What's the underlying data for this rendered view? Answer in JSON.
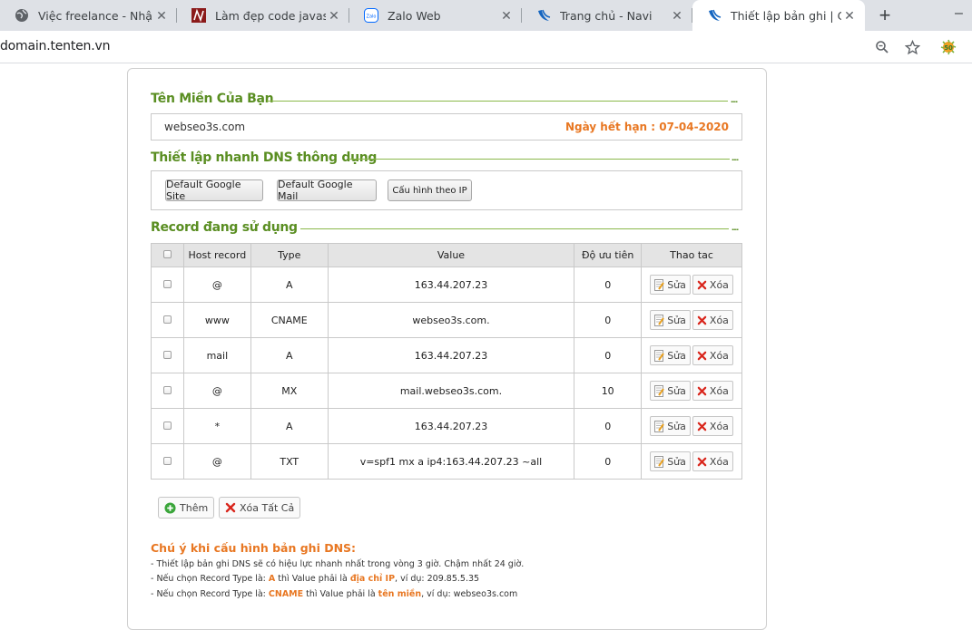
{
  "browser": {
    "tabs": [
      {
        "title": "Việc freelance - Nhận tiền",
        "icon": "globe-icon"
      },
      {
        "title": "Làm đẹp code javascript",
        "icon": "site-n-icon"
      },
      {
        "title": "Zalo Web",
        "icon": "zalo-icon"
      },
      {
        "title": "Trang chủ - Navi",
        "icon": "navi-icon"
      },
      {
        "title": "Thiết lập bản ghi | Cài đặt",
        "icon": "navi-icon"
      }
    ],
    "new_tab": "+",
    "minimize": "–",
    "address": "domain.tenten.vn"
  },
  "domain_section": {
    "title": "Tên Miền Của Bạn",
    "dots": "....",
    "domain": "webseo3s.com",
    "expiry": "Ngày hết hạn : 07-04-2020"
  },
  "quick_section": {
    "title": "Thiết lập nhanh DNS thông dụng",
    "dots": "....",
    "buttons": [
      "Default Google Site",
      "Default Google Mail",
      "Cấu hình theo IP"
    ]
  },
  "records_section": {
    "title": "Record đang sử dụng",
    "dots": "....",
    "headers": {
      "host": "Host record",
      "type": "Type",
      "value": "Value",
      "priority": "Độ ưu tiên",
      "actions": "Thao tac"
    },
    "edit_label": "Sửa",
    "delete_label": "Xóa",
    "rows": [
      {
        "host": "@",
        "type": "A",
        "value": "163.44.207.23",
        "priority": "0"
      },
      {
        "host": "www",
        "type": "CNAME",
        "value": "webseo3s.com.",
        "priority": "0"
      },
      {
        "host": "mail",
        "type": "A",
        "value": "163.44.207.23",
        "priority": "0"
      },
      {
        "host": "@",
        "type": "MX",
        "value": "mail.webseo3s.com.",
        "priority": "10"
      },
      {
        "host": "*",
        "type": "A",
        "value": "163.44.207.23",
        "priority": "0"
      },
      {
        "host": "@",
        "type": "TXT",
        "value": "v=spf1 mx a ip4:163.44.207.23 ~all",
        "priority": "0"
      }
    ],
    "add_label": "Thêm",
    "delete_all_label": "Xóa Tất Cả"
  },
  "notes": {
    "title": "Chú ý khi cấu hình bản ghi DNS:",
    "line1": "- Thiết lập bản ghi DNS sẽ có hiệu lực nhanh nhất trong vòng 3 giờ. Chậm nhất 24 giờ.",
    "line2": {
      "a": "- Nếu chọn Record Type là: ",
      "b": "A",
      "c": " thì Value phải là ",
      "d": "địa chỉ IP",
      "e": ", ví dụ: 209.85.5.35"
    },
    "line3": {
      "a": "- Nếu chọn Record Type là: ",
      "b": "CNAME",
      "c": " thì Value phải là ",
      "d": "tên miền",
      "e": ", ví dụ: webseo3s.com"
    }
  },
  "colors": {
    "accent_green": "#5a8e22",
    "accent_orange": "#e87722",
    "delete_red": "#d9261c"
  }
}
